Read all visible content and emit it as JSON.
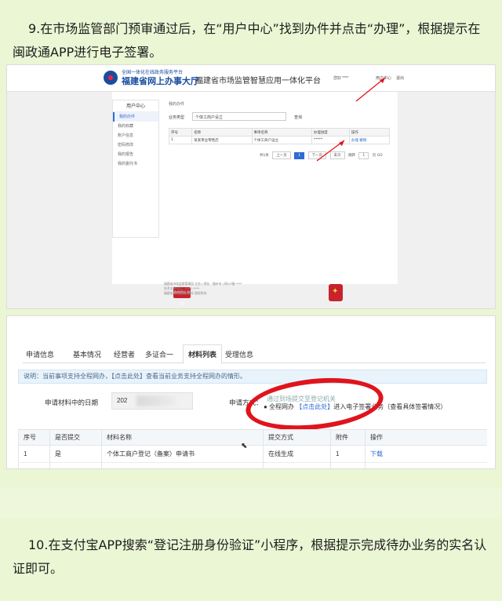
{
  "step9": {
    "text": "9.在市场监管部门预审通过后，在“用户中心”找到办件并点击“办理”，根据提示在闽政通APP进行电子签署。"
  },
  "step10": {
    "text": "10.在支付宝APP搜索“登记注册身份验证”小程序，根据提示完成待办业务的实名认证即可。"
  },
  "shot1": {
    "logo_small": "全国一体化在线政务服务平台",
    "logo_big": "福建省网上办事大厅",
    "platform_title": "福建省市场监管智慧应用一体化平台",
    "user_label": "您好 ****",
    "user_center": "用户中心",
    "logout": "退出",
    "sidebar": {
      "title": "用户中心",
      "items": [
        {
          "label": "我的办件",
          "active": true
        },
        {
          "label": "我的收藏",
          "active": false
        },
        {
          "label": "账户信息",
          "active": false
        },
        {
          "label": "密码修改",
          "active": false
        },
        {
          "label": "我的报告",
          "active": false
        },
        {
          "label": "我的委托书",
          "active": false
        }
      ]
    },
    "breadcrumb": "我的办件",
    "filter": {
      "label": "业务类型",
      "value": "个体工商户设立",
      "button": "查询"
    },
    "table": {
      "headers": [
        "序号",
        "名称",
        "事项名称",
        "办理进度",
        "操作"
      ],
      "rows": [
        {
          "no": "1",
          "name": "某某茶业零售店",
          "item": "个体工商户设立",
          "status": "*****",
          "action": "办理 撤销"
        }
      ]
    },
    "pager": {
      "total": "共1条",
      "prev": "上一页",
      "current": "1",
      "next": "下一页",
      "last": "末页",
      "goto_prefix": "跳转",
      "goto_value": "1",
      "goto_suffix": "页 GO"
    },
    "footer": {
      "line1": "福建省市场监督管理局 主办 | 地址：福州市 | 闽ICP备 ****",
      "line2": "技术支持电话：0591-****",
      "line3": "福建省市场监督管理局 版权所有"
    },
    "badge_left": "政府网站 找错"
  },
  "shot2": {
    "tabs": [
      {
        "label": "申请信息",
        "active": false
      },
      {
        "label": "基本情况",
        "active": false
      },
      {
        "label": "经营者",
        "active": false
      },
      {
        "label": "多证合一",
        "active": false
      },
      {
        "label": "材料列表",
        "active": true
      },
      {
        "label": "受理信息",
        "active": false
      }
    ],
    "note": "说明：当前事项支持全程网办，【点击此处】查看当前业务支持全程网办的情形。",
    "date_label": "申请材料中的日期",
    "date_value": "202",
    "method_label": "申请方式：",
    "method_option1": "通过到场提交至登记机关",
    "method_option2_prefix": "● 全程网办 ",
    "method_option2_link": "【点击此处】",
    "method_option2_suffix": "进入电子签署业务（查看具体签署情况）",
    "table": {
      "headers": [
        "序号",
        "是否提交",
        "材料名称",
        "提交方式",
        "附件",
        "操作"
      ],
      "rows": [
        {
          "no": "1",
          "submitted": "是",
          "name": "个体工商户登记（备案）申请书",
          "method": "在线生成",
          "attachments": "1",
          "action": "下载"
        }
      ]
    }
  },
  "colors": {
    "page_bg": "#eaf6d4",
    "link_blue": "#2d6cd6",
    "annotation_red": "#e0141c"
  }
}
